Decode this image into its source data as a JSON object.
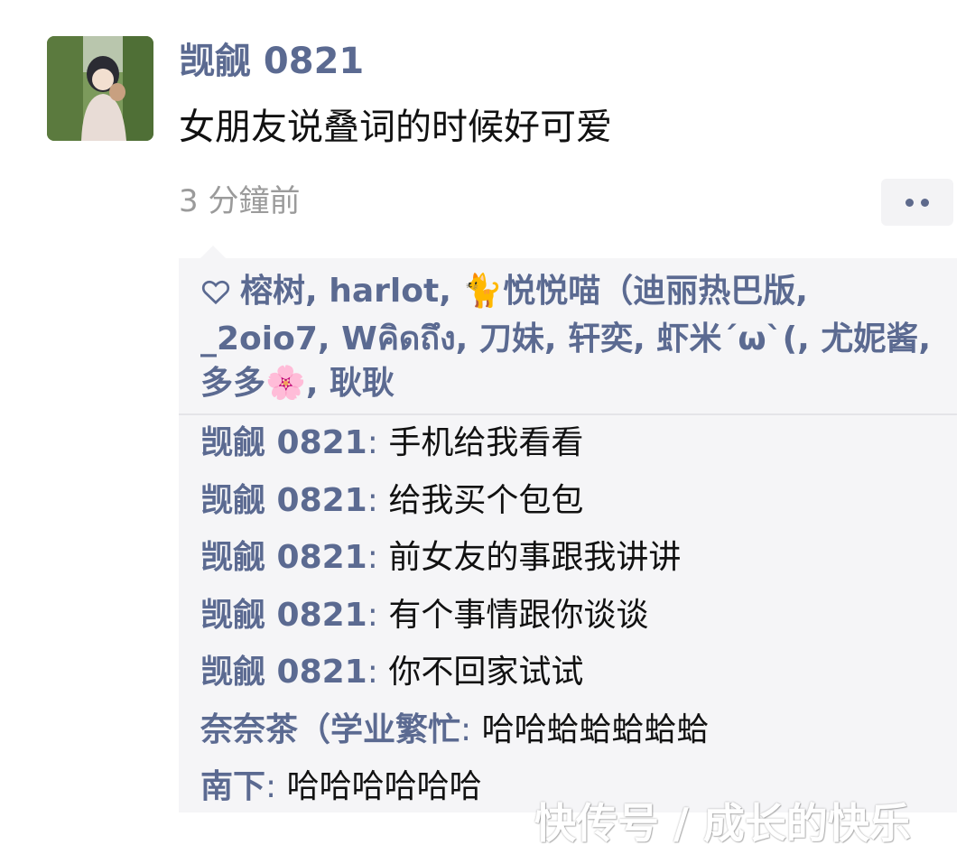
{
  "post": {
    "username": "觊觎 0821",
    "text": "女朋友说叠词的时候好可爱",
    "timestamp": "3 分鐘前"
  },
  "likes": {
    "icon": "heart-outline-icon",
    "names": [
      "榕树",
      "harlot",
      "🐈悦悦喵（迪丽热巴版",
      "_2oio7",
      "Wคิดถึง",
      "刀妹",
      "轩奕",
      "虾米´ω`(",
      "尤妮酱",
      "多多🌸",
      "耿耿"
    ]
  },
  "comments": [
    {
      "author": "觊觎 0821",
      "text": "手机给我看看"
    },
    {
      "author": "觊觎 0821",
      "text": "给我买个包包"
    },
    {
      "author": "觊觎 0821",
      "text": "前女友的事跟我讲讲"
    },
    {
      "author": "觊觎 0821",
      "text": "有个事情跟你谈谈"
    },
    {
      "author": "觊觎 0821",
      "text": "你不回家试试"
    },
    {
      "author": "奈奈茶（学业繁忙",
      "text": "哈哈蛤蛤蛤蛤蛤"
    },
    {
      "author": "南下",
      "text": "哈哈哈哈哈哈"
    }
  ],
  "watermark": "快传号 / 成长的快乐",
  "colors": {
    "link": "#5b6a91",
    "panel": "#f5f5f7",
    "meta": "#9b9b9b"
  }
}
